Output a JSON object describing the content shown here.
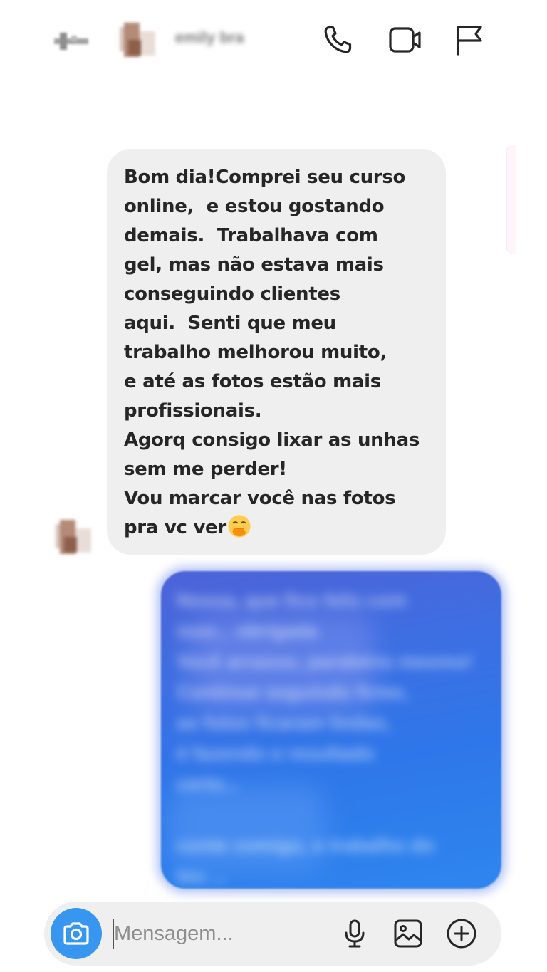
{
  "header": {
    "back_icon": "arrow-left-icon",
    "contact_name": "emily bra",
    "actions": [
      {
        "name": "audio-call",
        "icon": "phone-icon"
      },
      {
        "name": "video-call",
        "icon": "video-camera-icon"
      },
      {
        "name": "report",
        "icon": "flag-icon"
      }
    ]
  },
  "thread": {
    "incoming": {
      "text": "Bom dia!Comprei seu curso\nonline,  e estou gostando\ndemais.  Trabalhava com\ngel, mas não estava mais\nconseguindo clientes\naqui.  Senti que meu\ntrabalho melhorou muito,\ne até as fotos estão mais\nprofissionais.\nAgorq consigo lixar as unhas\nsem me perder!\nVou marcar você nas fotos\npra vc ver",
      "emoji": "face-with-hand-over-mouth-icon"
    },
    "outgoing": {
      "blurred": true,
      "text": "Nossa, que fico feliz com\nisso... obrigada\nVocê arrasou, parabéns mesmo!\nContinue seguindo firme,\nas fotos ficaram lindas,\né fazendo o resultado\ncerto...\n\nconte comigo, o trabalho do\nteu ..."
    },
    "colors": {
      "incoming_bubble": "#efefef",
      "outgoing_gradient_start": "#4e63d8",
      "outgoing_gradient_end": "#2f86ef"
    }
  },
  "composer": {
    "placeholder": "Mensagem...",
    "camera_icon": "camera-icon",
    "mic_icon": "microphone-icon",
    "gallery_icon": "image-gallery-icon",
    "plus_icon": "plus-circle-icon",
    "accent": "#3797f0"
  }
}
